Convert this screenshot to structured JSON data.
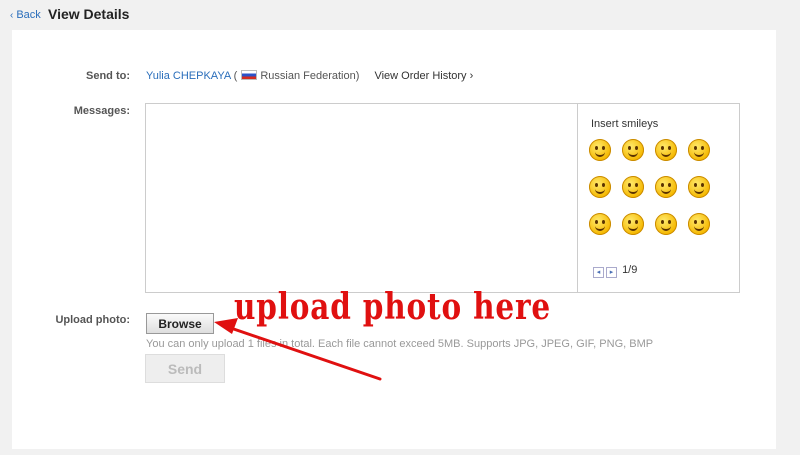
{
  "header": {
    "back_label": "Back",
    "title": "View Details"
  },
  "form": {
    "send_to_label": "Send to:",
    "recipient_name": "Yulia CHEPKAYA",
    "recipient_country": "Russian Federation",
    "order_history_label": "View Order History",
    "messages_label": "Messages:",
    "message_value": "",
    "upload_label": "Upload photo:",
    "browse_label": "Browse",
    "upload_note": "You can only upload 1 files in total. Each file cannot exceed 5MB. Supports JPG, JPEG, GIF, PNG, BMP",
    "send_label": "Send"
  },
  "smileys": {
    "title": "Insert smileys",
    "page": "1/9",
    "count": 12
  },
  "annotation": {
    "text": "upload photo here",
    "color": "#e01010"
  },
  "colors": {
    "link": "#2a6ebb",
    "annotation": "#e01010"
  }
}
